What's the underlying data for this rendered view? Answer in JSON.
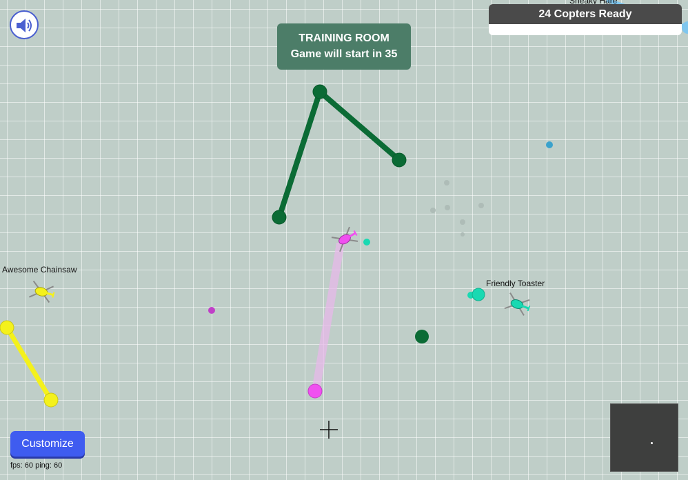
{
  "hud": {
    "room_title": "TRAINING ROOM",
    "countdown_text": "Game will start in 35",
    "copters_ready": "24 Copters Ready",
    "customize_label": "Customize",
    "stats_text": "fps: 60 ping: 60"
  },
  "players": {
    "left": "Awesome Chainsaw",
    "right": "Friendly Toaster",
    "top_partial": "Sneaky Hare"
  },
  "colors": {
    "background": "#bfcec8",
    "green_rope": "#0b6b35",
    "yellow_rope": "#f4f11c",
    "pink": "#f050f0",
    "cyan": "#19d9b2",
    "panel_green": "#4c7d68",
    "button_blue": "#3f5cf0"
  },
  "icons": {
    "sound": "speaker-icon",
    "crosshair": "crosshair-icon"
  }
}
